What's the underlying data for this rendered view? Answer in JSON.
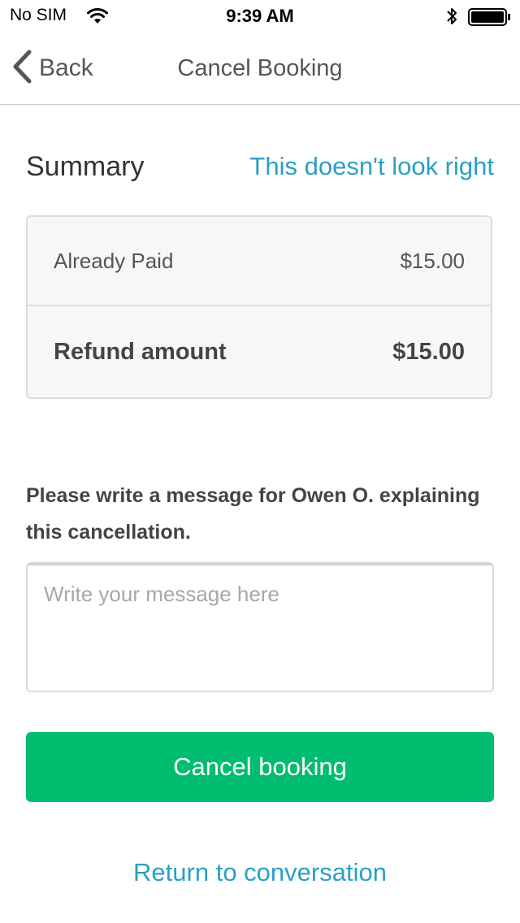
{
  "status_bar": {
    "carrier": "No SIM",
    "time": "9:39 AM",
    "icons": [
      "wifi-icon",
      "bluetooth-icon",
      "battery-icon"
    ]
  },
  "nav": {
    "back_label": "Back",
    "back_icon": "chevron-left-icon",
    "title": "Cancel Booking"
  },
  "summary": {
    "title": "Summary",
    "dispute_link": "This doesn't look right",
    "rows": [
      {
        "label": "Already Paid",
        "value": "$15.00"
      },
      {
        "label": "Refund amount",
        "value": "$15.00"
      }
    ]
  },
  "message": {
    "prompt": "Please write a message for Owen O. explaining this cancellation.",
    "placeholder": "Write your message here",
    "value": ""
  },
  "actions": {
    "cancel_label": "Cancel booking",
    "return_label": "Return to conversation"
  },
  "colors": {
    "accent_link": "#2aa0c4",
    "primary_button": "#00bd6f",
    "card_background": "#f7f7f7",
    "border": "#dcdcdc"
  }
}
